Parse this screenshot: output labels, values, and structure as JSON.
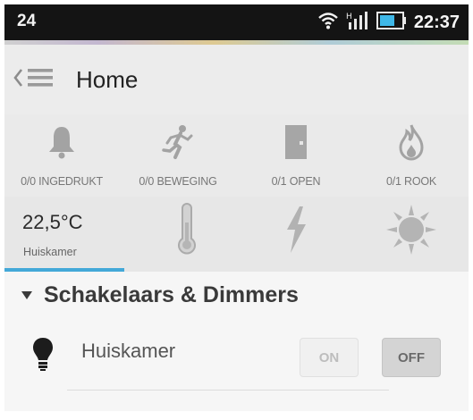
{
  "statusbar": {
    "notification": "24",
    "time": "22:37",
    "icons": [
      "wifi-icon",
      "signal-icon",
      "battery-icon"
    ]
  },
  "appbar": {
    "title": "Home",
    "icons": [
      "back-chevron-icon",
      "menu-icon"
    ]
  },
  "sensors": [
    {
      "label": "0/0 INGEDRUKT",
      "icon": "bell-icon"
    },
    {
      "label": "0/0 BEWEGING",
      "icon": "running-person-icon"
    },
    {
      "label": "0/1 OPEN",
      "icon": "door-icon"
    },
    {
      "label": "0/1 ROOK",
      "icon": "flame-icon"
    }
  ],
  "weather": {
    "temperature": "22,5°C",
    "room": "Huiskamer",
    "icons": [
      "thermometer-icon",
      "lightning-icon",
      "sun-icon"
    ]
  },
  "section": {
    "title": "Schakelaars & Dimmers",
    "icon": "triangle-down-icon"
  },
  "switches": [
    {
      "name": "Huiskamer",
      "on_label": "ON",
      "off_label": "OFF",
      "state": "off",
      "icon": "bulb-icon"
    }
  ],
  "colors": {
    "accent": "#43a8d8",
    "statusbar": "#141414",
    "icon_gray": "#9c9c9c"
  }
}
